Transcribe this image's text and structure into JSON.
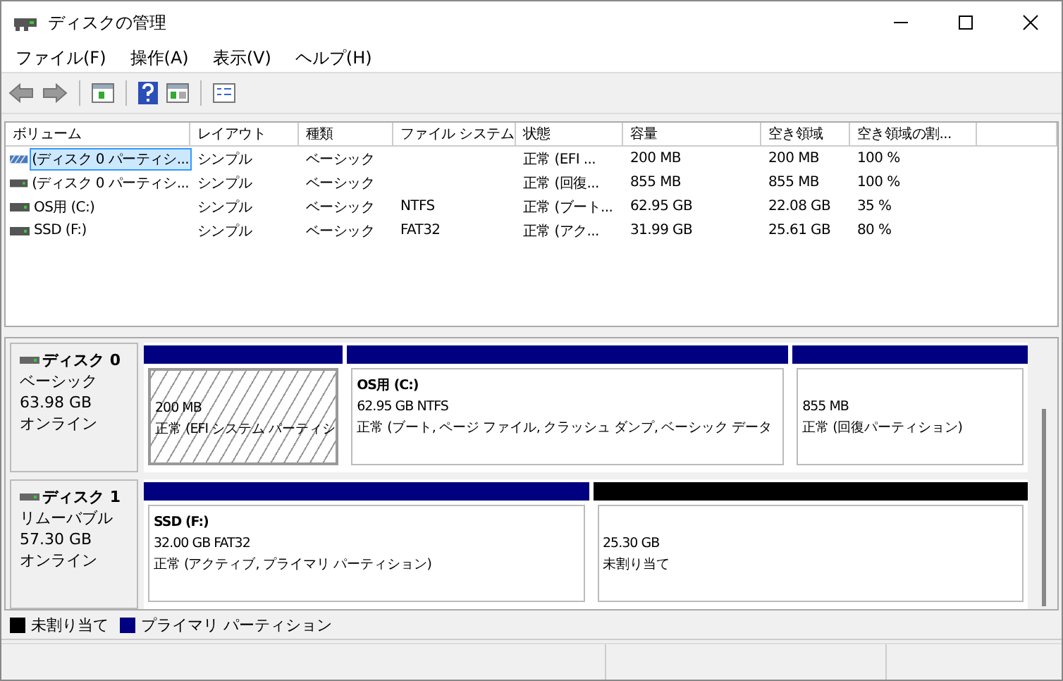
{
  "window": {
    "title": "ディスクの管理"
  },
  "menu": [
    "ファイル(F)",
    "操作(A)",
    "表示(V)",
    "ヘルプ(H)"
  ],
  "table": {
    "columns": [
      "ボリューム",
      "レイアウト",
      "種類",
      "ファイル システム",
      "状態",
      "容量",
      "空き領域",
      "空き領域の割..."
    ],
    "rows": [
      {
        "selected": true,
        "kind": "efi",
        "cells": [
          "(ディスク 0 パーティシ...",
          "シンプル",
          "ベーシック",
          "",
          "正常 (EFI ...",
          "200 MB",
          "200 MB",
          "100 %"
        ]
      },
      {
        "selected": false,
        "kind": "drive",
        "cells": [
          "(ディスク 0 パーティシ...",
          "シンプル",
          "ベーシック",
          "",
          "正常 (回復...",
          "855 MB",
          "855 MB",
          "100 %"
        ]
      },
      {
        "selected": false,
        "kind": "drive",
        "cells": [
          "OS用 (C:)",
          "シンプル",
          "ベーシック",
          "NTFS",
          "正常 (ブート...",
          "62.95 GB",
          "22.08 GB",
          "35 %"
        ]
      },
      {
        "selected": false,
        "kind": "drive",
        "cells": [
          "SSD (F:)",
          "シンプル",
          "ベーシック",
          "FAT32",
          "正常 (アク...",
          "31.99 GB",
          "25.61 GB",
          "80 %"
        ]
      }
    ]
  },
  "disks": [
    {
      "name": "ディスク 0",
      "type": "ベーシック",
      "size": "63.98 GB",
      "status": "オンライン",
      "partitions": [
        {
          "color": "#000080",
          "selected": true,
          "lines": [
            "200 MB",
            "正常 (EFI システム パーティシ"
          ]
        },
        {
          "color": "#000080",
          "selected": false,
          "title": "OS用  (C:)",
          "lines": [
            "62.95 GB NTFS",
            "正常 (ブート, ページ ファイル, クラッシュ ダンプ, ベーシック データ"
          ]
        },
        {
          "color": "#000080",
          "selected": false,
          "lines": [
            "855 MB",
            "正常 (回復パーティション)"
          ]
        }
      ]
    },
    {
      "name": "ディスク 1",
      "type": "リムーバブル",
      "size": "57.30 GB",
      "status": "オンライン",
      "partitions": [
        {
          "color": "#000080",
          "selected": false,
          "title": "SSD  (F:)",
          "lines": [
            "32.00 GB FAT32",
            "正常 (アクティブ, プライマリ パーティション)"
          ]
        },
        {
          "color": "#000000",
          "selected": false,
          "lines": [
            "25.30 GB",
            "未割り当て"
          ]
        }
      ]
    }
  ],
  "legend": [
    {
      "color": "#000000",
      "label": "未割り当て"
    },
    {
      "color": "#000080",
      "label": "プライマリ パーティション"
    }
  ]
}
